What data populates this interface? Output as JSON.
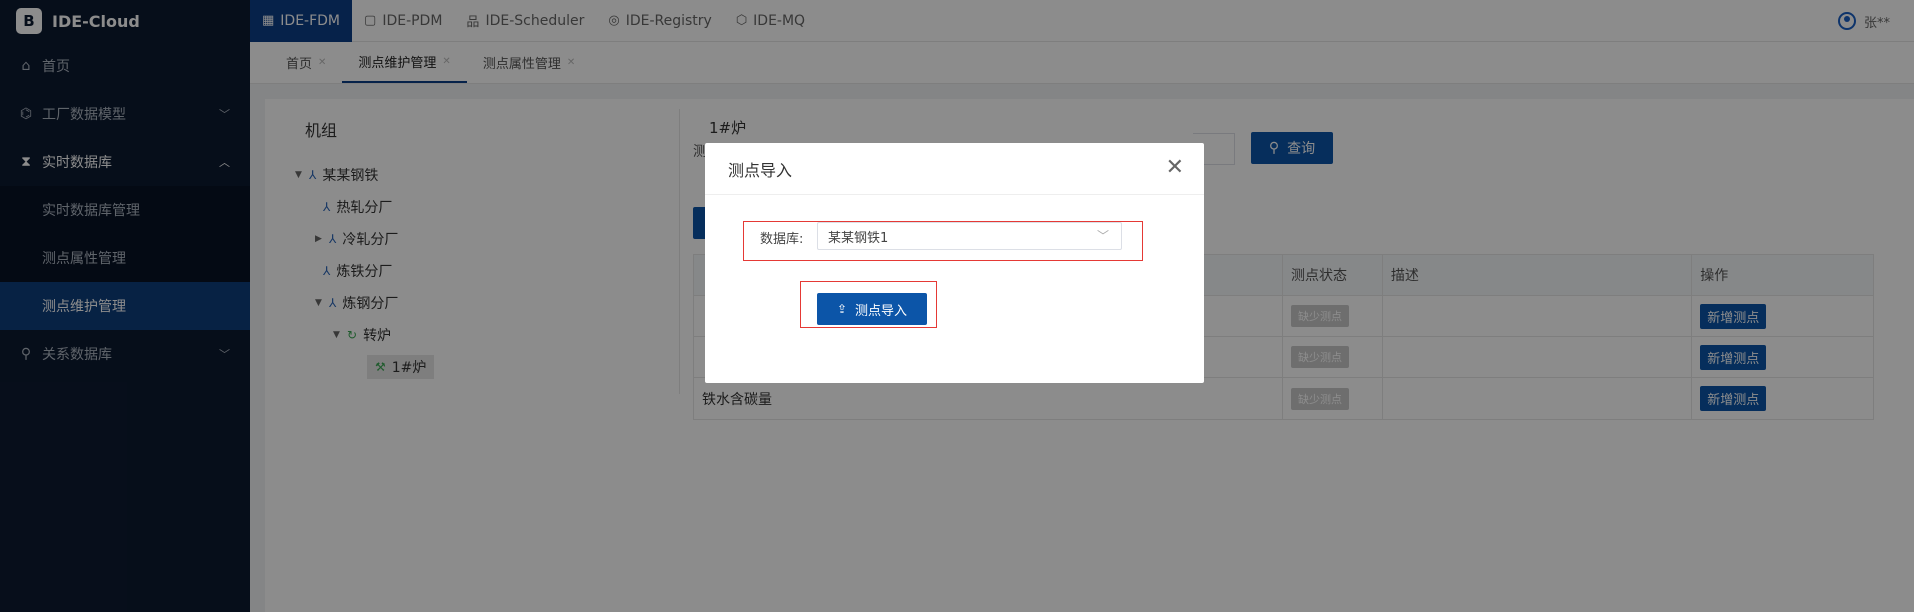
{
  "brand": {
    "name": "IDE-Cloud",
    "logo_char": "B"
  },
  "sidebar": {
    "items": [
      {
        "label": "首页",
        "icon": "home-icon"
      },
      {
        "label": "工厂数据模型",
        "icon": "factory-icon"
      },
      {
        "label": "实时数据库",
        "icon": "hourglass-icon"
      },
      {
        "label": "关系数据库",
        "icon": "link-icon"
      }
    ],
    "sub_items": [
      {
        "label": "实时数据库管理"
      },
      {
        "label": "测点属性管理"
      },
      {
        "label": "测点维护管理"
      }
    ]
  },
  "topbar": {
    "tabs": [
      {
        "label": "IDE-FDM"
      },
      {
        "label": "IDE-PDM"
      },
      {
        "label": "IDE-Scheduler"
      },
      {
        "label": "IDE-Registry"
      },
      {
        "label": "IDE-MQ"
      }
    ],
    "user": "张**"
  },
  "crumbs": [
    {
      "label": "首页"
    },
    {
      "label": "测点维护管理"
    },
    {
      "label": "测点属性管理"
    }
  ],
  "left_panel": {
    "title": "机组",
    "tree": [
      {
        "label": "某某钢铁"
      },
      {
        "label": "热轧分厂"
      },
      {
        "label": "冷轧分厂"
      },
      {
        "label": "炼铁分厂"
      },
      {
        "label": "炼钢分厂"
      },
      {
        "label": "转炉"
      },
      {
        "label": "1#炉"
      }
    ]
  },
  "right_panel": {
    "title": "1#炉",
    "label_prefix": "测",
    "query_label": "查询",
    "table": {
      "headers": [
        "",
        "测点状态",
        "描述",
        "操作"
      ],
      "rows": [
        {
          "name": "",
          "status": "缺少测点",
          "desc": "",
          "op": "新增测点"
        },
        {
          "name": "",
          "status": "缺少测点",
          "desc": "",
          "op": "新增测点"
        },
        {
          "name": "铁水含碳量",
          "status": "缺少测点",
          "desc": "",
          "op": "新增测点"
        }
      ]
    }
  },
  "modal": {
    "title": "测点导入",
    "db_label": "数据库:",
    "db_value": "某某钢铁1",
    "import_label": "测点导入"
  },
  "colors": {
    "sidebar_bg": "#0c1a31",
    "primary": "#0c55a8",
    "highlight": "#e53935"
  }
}
